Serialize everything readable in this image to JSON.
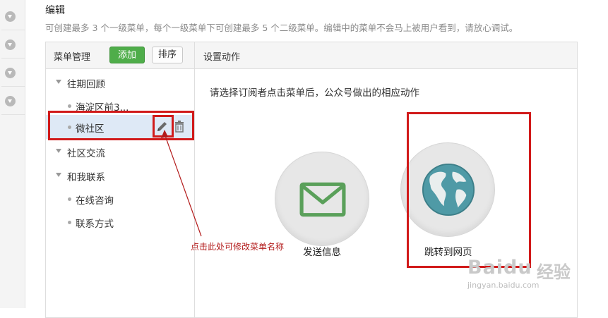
{
  "section": {
    "title": "编辑",
    "description": "可创建最多 3 个一级菜单，每个一级菜单下可创建最多 5 个二级菜单。编辑中的菜单不会马上被用户看到，请放心调试。"
  },
  "menu_panel": {
    "title": "菜单管理",
    "add_label": "添加",
    "sort_label": "排序",
    "items": [
      {
        "label": "往期回顾",
        "level": 1
      },
      {
        "label": "海淀区前3...",
        "level": 2
      },
      {
        "label": "微社区",
        "level": 2,
        "selected": true
      },
      {
        "label": "社区交流",
        "level": 1
      },
      {
        "label": "和我联系",
        "level": 1
      },
      {
        "label": "在线咨询",
        "level": 2
      },
      {
        "label": "联系方式",
        "level": 2
      }
    ]
  },
  "action_panel": {
    "title": "设置动作",
    "prompt": "请选择订阅者点击菜单后，公众号做出的相应动作",
    "options": [
      {
        "label": "发送信息",
        "icon": "envelope-icon",
        "color": "#5aa05a"
      },
      {
        "label": "跳转到网页",
        "icon": "globe-icon",
        "color": "#4f9aa6"
      }
    ]
  },
  "annotation": {
    "text": "点击此处可修改菜单名称",
    "color": "#b31b1b"
  },
  "watermark": {
    "logo": "Baidu",
    "cn": "经验",
    "url": "jingyan.baidu.com"
  },
  "colors": {
    "accent_green": "#4fad4a",
    "highlight_red": "#d11a1a",
    "selected_row": "#dee9f6"
  }
}
